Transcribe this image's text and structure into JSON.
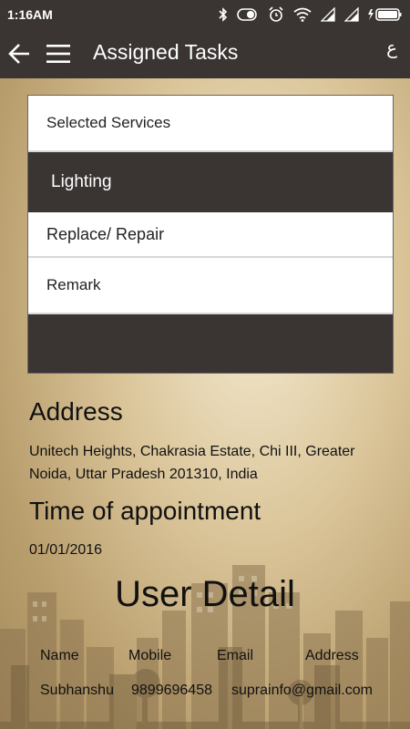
{
  "status_bar": {
    "time": "1:16AM",
    "icons": [
      "bluetooth-icon",
      "battery-saver-icon",
      "alarm-icon",
      "wifi-icon",
      "signal-icon",
      "signal-icon",
      "battery-charging-icon"
    ]
  },
  "app_bar": {
    "title": "Assigned Tasks",
    "language_glyph": "ع"
  },
  "services": {
    "header": "Selected Services",
    "category": "Lighting",
    "service": "Replace/ Repair",
    "remark_label": "Remark",
    "remark_value": ""
  },
  "address": {
    "heading": "Address",
    "text": "Unitech Heights, Chakrasia Estate, Chi III, Greater Noida, Uttar Pradesh 201310, India"
  },
  "appointment": {
    "heading": "Time of appointment",
    "date": "01/01/2016"
  },
  "user_detail": {
    "heading": "User Detail",
    "columns": [
      "Name",
      "Mobile",
      "Email",
      "Address"
    ],
    "values": [
      "Subhanshu",
      "9899696458",
      "suprainfo@gmail.com",
      ""
    ]
  },
  "colors": {
    "bar": "#3a3533",
    "background": "#d9c499"
  }
}
